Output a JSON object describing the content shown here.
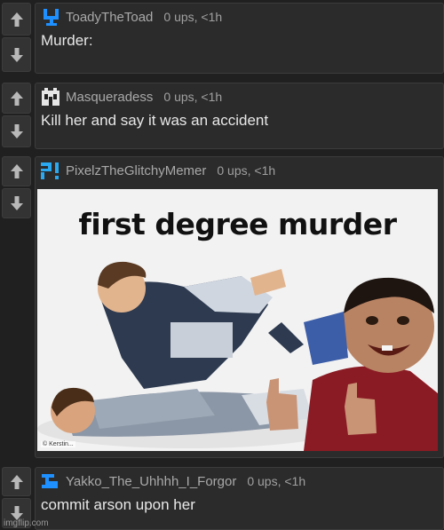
{
  "comments": [
    {
      "username": "ToadyTheToad",
      "meta": "0 ups, <1h",
      "text": "Murder:",
      "avatar_color": "#1e90ff",
      "avatar_icon": "toad-pixel-avatar-icon"
    },
    {
      "username": "Masqueradess",
      "meta": "0 ups, <1h",
      "text": "Kill her and say it was an accident",
      "avatar_color": "#e6e6e6",
      "avatar_icon": "mask-pixel-avatar-icon"
    },
    {
      "username": "PixelzTheGlitchyMemer",
      "meta": "0 ups, <1h",
      "avatar_color": "#2aa8f0",
      "avatar_icon": "glitch-pixel-avatar-icon",
      "image": {
        "caption": "first degree murder",
        "credit": "© Kerstin..."
      }
    },
    {
      "username": "Yakko_The_Uhhhh_I_Forgor",
      "meta": "0 ups, <1h",
      "text": "commit arson upon her",
      "avatar_color": "#1e90ff",
      "avatar_icon": "pixel-avatar-icon"
    }
  ],
  "watermark": "imgflip.com",
  "icons": {
    "upvote": "arrow-up-icon",
    "downvote": "arrow-down-icon"
  }
}
